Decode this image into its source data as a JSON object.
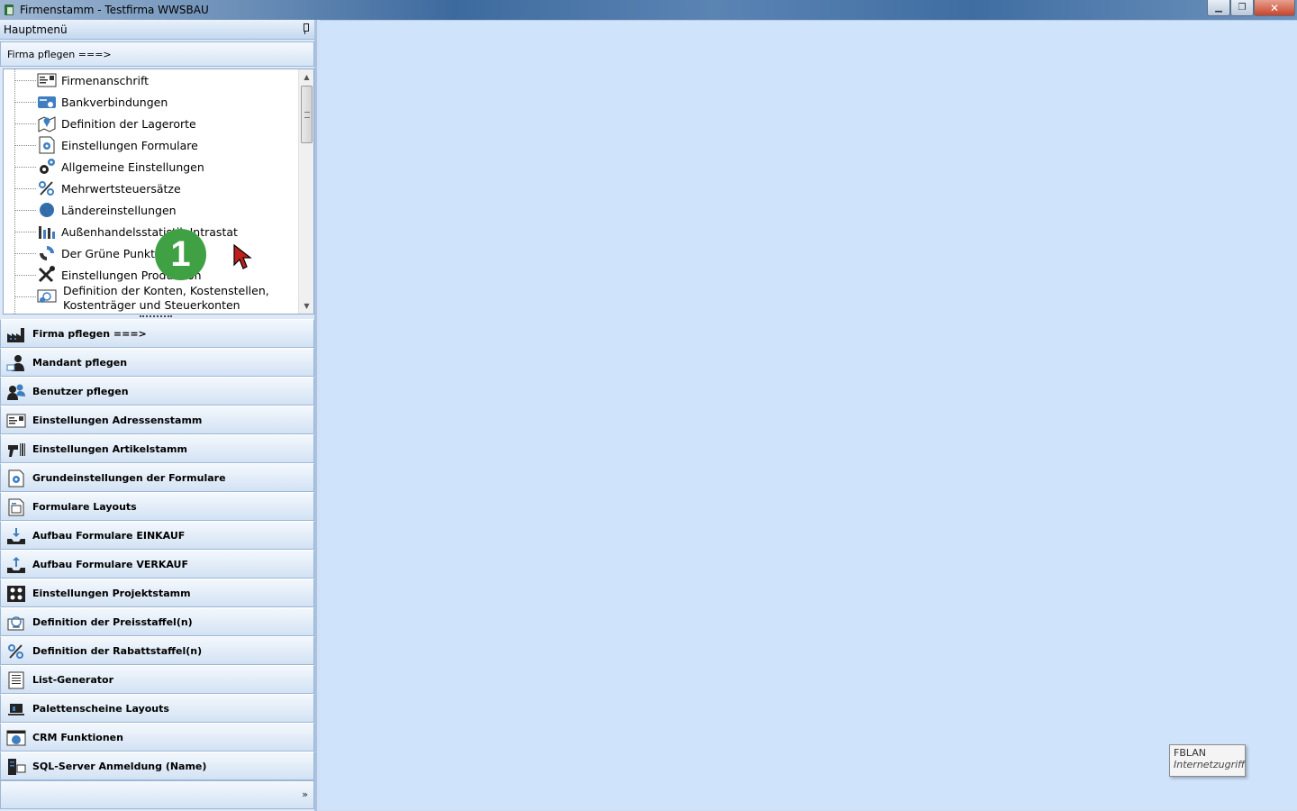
{
  "window": {
    "title": "Firmenstamm - Testfirma WWSBAU",
    "minimize_label": "▁",
    "restore_label": "❐",
    "close_label": "✕"
  },
  "sidebar": {
    "title": "Hauptmenü",
    "group_header": "Firma pflegen   ===>",
    "tree_items": [
      {
        "label": "Firmenanschrift",
        "icon": "address-card-icon"
      },
      {
        "label": "Bankverbindungen",
        "icon": "bank-card-icon"
      },
      {
        "label": "Definition der Lagerorte",
        "icon": "map-pin-icon"
      },
      {
        "label": "Einstellungen Formulare",
        "icon": "form-gear-icon"
      },
      {
        "label": "Allgemeine Einstellungen",
        "icon": "gears-icon"
      },
      {
        "label": "Mehrwertsteuersätze",
        "icon": "percent-icon"
      },
      {
        "label": "Ländereinstellungen",
        "icon": "globe-icon"
      },
      {
        "label": "Außenhandelsstatistik Intrastat",
        "icon": "bar-chart-icon"
      },
      {
        "label": "Der Grüne Punkt",
        "icon": "green-dot-icon"
      },
      {
        "label": "Einstellungen Produktion",
        "icon": "tools-icon"
      },
      {
        "label": "Definition der Konten, Kostenstellen,",
        "label2": "Kostenträger und Steuerkonten",
        "icon": "money-icon"
      }
    ],
    "nav_items": [
      {
        "label": "Firma pflegen    ===>",
        "icon": "factory-icon"
      },
      {
        "label": "Mandant pflegen",
        "icon": "client-icon"
      },
      {
        "label": "Benutzer pflegen",
        "icon": "users-icon"
      },
      {
        "label": "Einstellungen Adressenstamm",
        "icon": "address-card-icon"
      },
      {
        "label": "Einstellungen Artikelstamm",
        "icon": "scanner-icon"
      },
      {
        "label": "Grundeinstellungen der Formulare",
        "icon": "form-gear-icon"
      },
      {
        "label": "Formulare Layouts",
        "icon": "form-layout-icon"
      },
      {
        "label": "Aufbau Formulare EINKAUF",
        "icon": "inbox-down-icon"
      },
      {
        "label": "Aufbau Formulare VERKAUF",
        "icon": "inbox-up-icon"
      },
      {
        "label": "Einstellungen Projektstamm",
        "icon": "project-icon"
      },
      {
        "label": "Definition der Preisstaffel(n)",
        "icon": "price-icon"
      },
      {
        "label": "Definition der Rabattstaffel(n)",
        "icon": "discount-icon"
      },
      {
        "label": "List-Generator",
        "icon": "list-icon"
      },
      {
        "label": "Palettenscheine Layouts",
        "icon": "pallet-icon"
      },
      {
        "label": "CRM Funktionen",
        "icon": "crm-icon"
      },
      {
        "label": "SQL-Server Anmeldung (Name)",
        "icon": "server-icon"
      }
    ],
    "footer_chevron": "»"
  },
  "overlay": {
    "marker_number": "1"
  },
  "tooltip": {
    "line1": "FBLAN",
    "line2": "Internetzugriff"
  },
  "colors": {
    "accent": "#3fa044",
    "main_bg": "#cfe3fb"
  }
}
